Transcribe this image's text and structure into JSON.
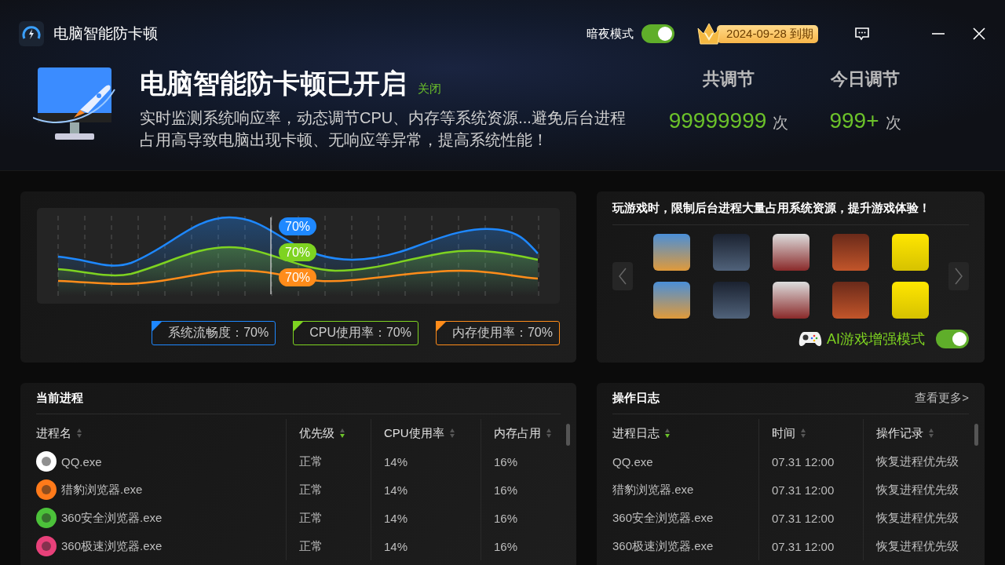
{
  "window": {
    "title": "电脑智能防卡顿"
  },
  "header": {
    "dark_mode": {
      "label": "暗夜模式",
      "on": true
    },
    "vip_badge": "2024-09-28 到期",
    "headline": "电脑智能防卡顿已开启",
    "close_link": "关闭",
    "description_lines": [
      "实时监测系统响应率，动态调节CPU、内存等系统资源...避免后台进程",
      "占用高导致电脑出现卡顿、无响应等异常，提高系统性能！"
    ],
    "stats": [
      {
        "label": "共调节",
        "value": "99999999",
        "unit": "次"
      },
      {
        "label": "今日调节",
        "value": "999+",
        "unit": "次"
      }
    ]
  },
  "chart": {
    "callouts": [
      {
        "text": "70%",
        "color": "#1e88ff"
      },
      {
        "text": "70%",
        "color": "#7ed321"
      },
      {
        "text": "70%",
        "color": "#ff8c1a"
      }
    ],
    "legend": [
      {
        "label": "系统流畅度：70%",
        "color": "#1e88ff"
      },
      {
        "label": "CPU使用率：70%",
        "color": "#7ed321"
      },
      {
        "label": "内存使用率：70%",
        "color": "#ff8c1a"
      }
    ]
  },
  "games": {
    "title": "玩游戏时，限制后台进程大量占用系统资源，提升游戏体验！",
    "ai_mode": {
      "label": "AI游戏增强模式",
      "on": true
    }
  },
  "processes": {
    "title": "当前进程",
    "columns": [
      {
        "label": "进程名",
        "sorted": false
      },
      {
        "label": "优先级",
        "sorted": true
      },
      {
        "label": "CPU使用率",
        "sorted": false
      },
      {
        "label": "内存占用",
        "sorted": false
      }
    ],
    "rows": [
      {
        "name": "QQ.exe",
        "color": "#ffffff",
        "priority": "正常",
        "cpu": "14%",
        "memory": "16%"
      },
      {
        "name": "猎豹浏览器.exe",
        "color": "#ff7a1a",
        "priority": "正常",
        "cpu": "14%",
        "memory": "16%"
      },
      {
        "name": "360安全浏览器.exe",
        "color": "#4cc13a",
        "priority": "正常",
        "cpu": "14%",
        "memory": "16%"
      },
      {
        "name": "360极速浏览器.exe",
        "color": "#e8417a",
        "priority": "正常",
        "cpu": "14%",
        "memory": "16%"
      }
    ]
  },
  "log": {
    "title": "操作日志",
    "more_link": "查看更多>",
    "columns": [
      {
        "label": "进程日志",
        "sorted": true
      },
      {
        "label": "时间",
        "sorted": false
      },
      {
        "label": "操作记录",
        "sorted": false
      }
    ],
    "rows": [
      {
        "process": "QQ.exe",
        "time": "07.31 12:00",
        "action": "恢复进程优先级"
      },
      {
        "process": "猎豹浏览器.exe",
        "time": "07.31 12:00",
        "action": "恢复进程优先级"
      },
      {
        "process": "360安全浏览器.exe",
        "time": "07.31 12:00",
        "action": "恢复进程优先级"
      },
      {
        "process": "360极速浏览器.exe",
        "time": "07.31 12:00",
        "action": "恢复进程优先级"
      }
    ]
  }
}
